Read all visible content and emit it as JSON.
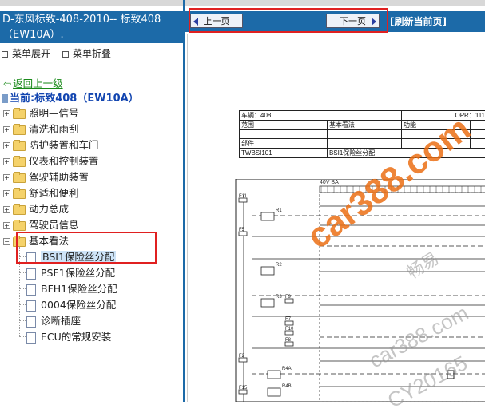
{
  "left_panel": {
    "title": "D-东风标致-408-2010-- 标致408（EW10A）.",
    "expand_all": "菜单展开",
    "collapse_all": "菜单折叠",
    "back_link": "返回上一级",
    "current": "当前:标致408（EW10A）",
    "folders": [
      "照明—信号",
      "清洗和雨刮",
      "防护装置和车门",
      "仪表和控制装置",
      "驾驶辅助装置",
      "舒适和便利",
      "动力总成",
      "驾驶员信息"
    ],
    "open_folder": "基本看法",
    "docs": [
      "BSI1保险丝分配",
      "PSF1保险丝分配",
      "BFH1保险丝分配",
      "0004保险丝分配",
      "诊断插座",
      "ECU的常规安装"
    ]
  },
  "nav": {
    "prev": "上一页",
    "next": "下一页",
    "refresh": "[刷新当前页]"
  },
  "document": {
    "vehicle_label": "车辆：408",
    "opr_label": "OPR：111",
    "scope_label": "范围",
    "basic_label": "基本看法",
    "function_label": "功能",
    "part_label": "部件",
    "code": "TWBSI101",
    "doc_title": "BSI1保险丝分配",
    "voltage": "40V BA",
    "fuses": [
      "F11",
      "R1",
      "F5",
      "R2",
      "R3",
      "F9",
      "F7",
      "F10",
      "F8",
      "F2",
      "R4A",
      "F15",
      "R4B"
    ]
  },
  "watermarks": [
    "car388.com",
    "畅易",
    "car388.com",
    "CY20165"
  ],
  "colors": {
    "panel_blue": "#1c6aa8",
    "highlight_red": "#e02020",
    "link_green": "#1a8a1a",
    "current_blue": "#1245b0"
  }
}
